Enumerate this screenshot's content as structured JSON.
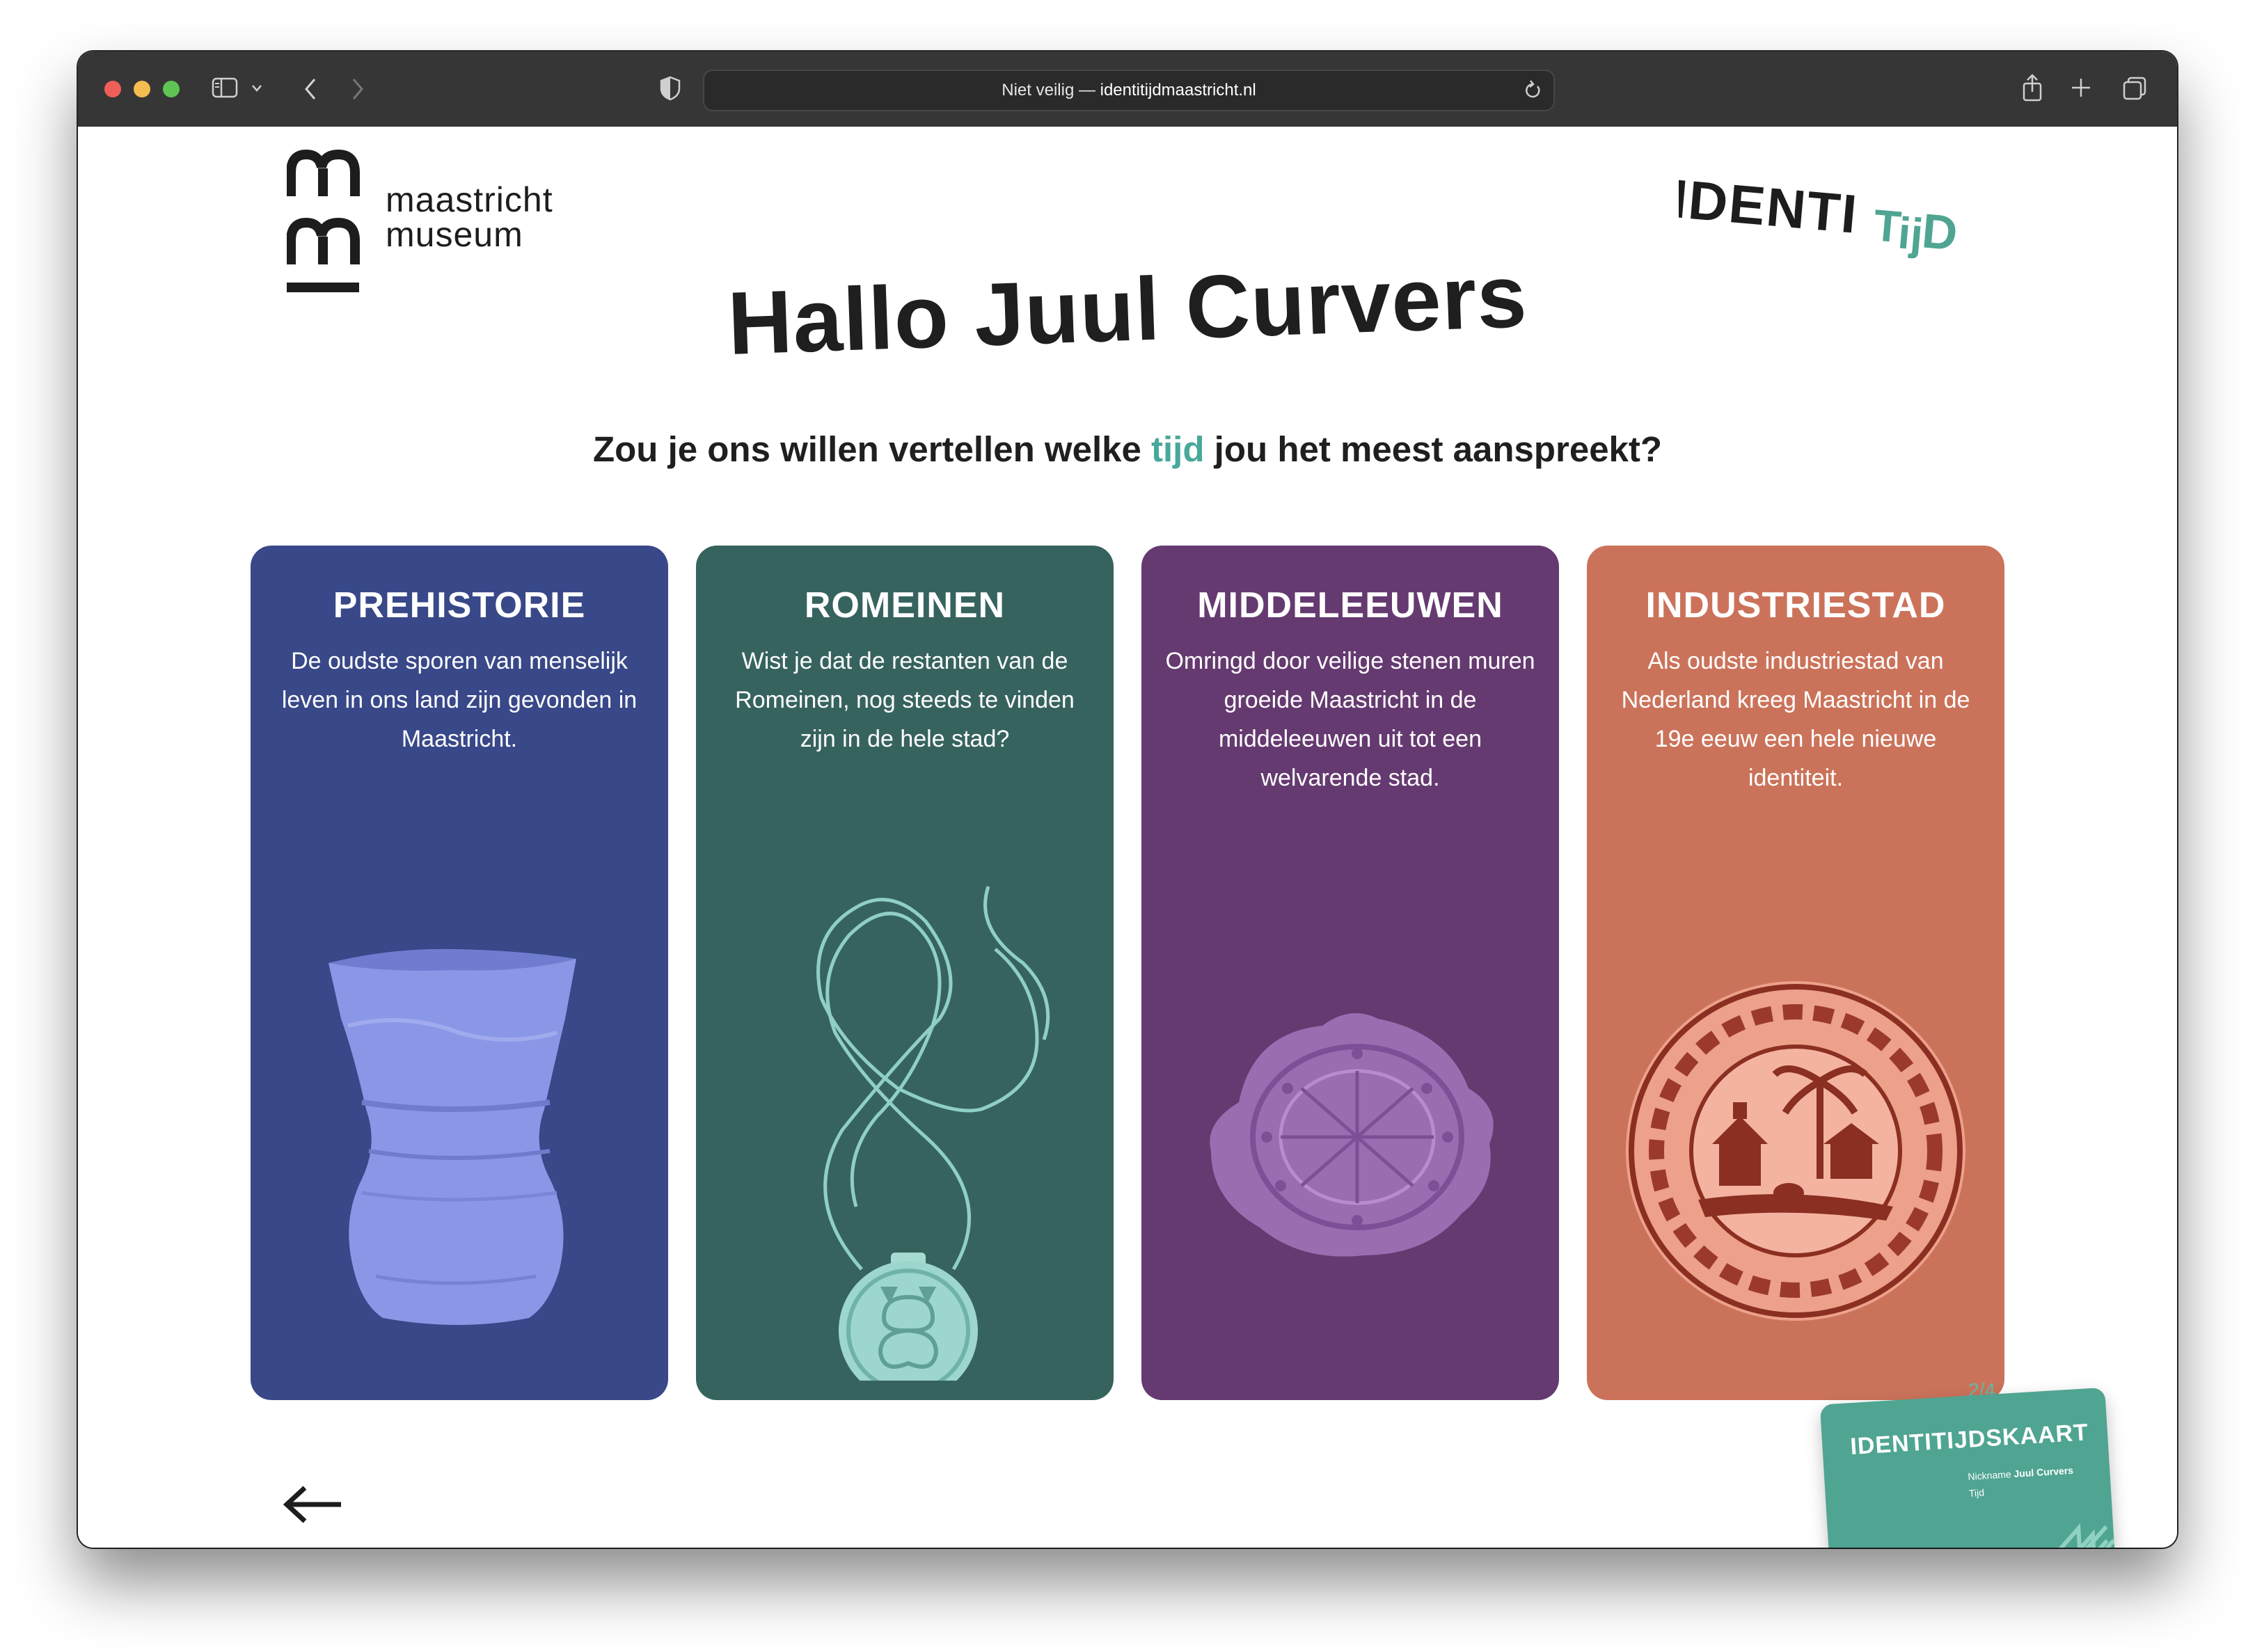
{
  "browser": {
    "address_prefix": "Niet veilig — ",
    "address_domain": "identitijdmaastricht.nl",
    "colors": {
      "close": "#ee5f57",
      "minimize": "#f5bd4f",
      "zoom": "#5fc454"
    },
    "icons": [
      "sidebar-icon",
      "back-icon",
      "forward-icon",
      "shield-icon",
      "reload-icon",
      "share-icon",
      "new-tab-icon",
      "tabs-overview-icon"
    ]
  },
  "header": {
    "museum_line1": "maastricht",
    "museum_line2": "museum",
    "brand": "IDENTITIJD"
  },
  "main": {
    "greeting": "Hallo Juul Curvers",
    "question_before": "Zou je ons willen vertellen welke ",
    "question_accent": "tijd",
    "question_after": " jou het meest aanspreekt?",
    "accent_color": "#48a89a"
  },
  "cards": [
    {
      "title": "PREHISTORIE",
      "text": "De oudste sporen van menselijk leven in ons land zijn gevonden in Maastricht.",
      "color": "#384888",
      "image": "beaker-pot"
    },
    {
      "title": "ROMEINEN",
      "text": "Wist je dat de restanten van de Romeinen, nog steeds te vinden zijn in de hele stad?",
      "color": "#37635f",
      "image": "necklace-pendant"
    },
    {
      "title": "MIDDELEEUWEN",
      "text": "Omringd door veilige stenen muren groeide Maastricht in de middeleeuwen uit tot een welvarende stad.",
      "color": "#653a70",
      "image": "metal-disc"
    },
    {
      "title": "INDUSTRIESTAD",
      "text": "Als oudste industriestad van Nederland kreeg Maastricht in de 19e eeuw een hele nieuwe identiteit.",
      "color": "#cb735a",
      "image": "decorated-plate"
    }
  ],
  "footer": {
    "back_icon": "arrow-left-icon",
    "page_indicator": "2/4"
  },
  "id_card": {
    "title": "IDENTITIJDSKAART",
    "nickname_label": "Nickname",
    "nickname_value": "Juul Curvers",
    "time_label": "Tijd",
    "color": "#4fa592"
  }
}
